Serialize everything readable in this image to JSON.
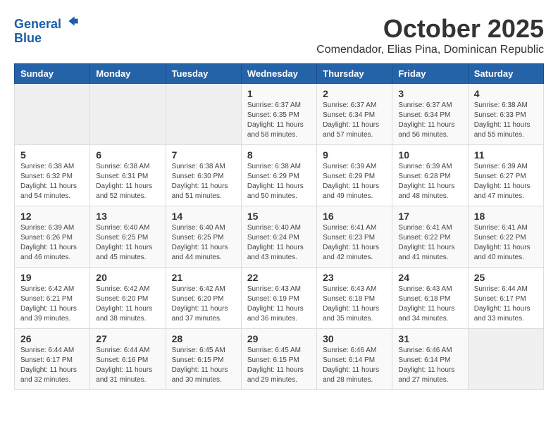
{
  "header": {
    "logo_line1": "General",
    "logo_line2": "Blue",
    "month": "October 2025",
    "location": "Comendador, Elias Pina, Dominican Republic"
  },
  "weekdays": [
    "Sunday",
    "Monday",
    "Tuesday",
    "Wednesday",
    "Thursday",
    "Friday",
    "Saturday"
  ],
  "weeks": [
    [
      {
        "day": "",
        "info": ""
      },
      {
        "day": "",
        "info": ""
      },
      {
        "day": "",
        "info": ""
      },
      {
        "day": "1",
        "info": "Sunrise: 6:37 AM\nSunset: 6:35 PM\nDaylight: 11 hours and 58 minutes."
      },
      {
        "day": "2",
        "info": "Sunrise: 6:37 AM\nSunset: 6:34 PM\nDaylight: 11 hours and 57 minutes."
      },
      {
        "day": "3",
        "info": "Sunrise: 6:37 AM\nSunset: 6:34 PM\nDaylight: 11 hours and 56 minutes."
      },
      {
        "day": "4",
        "info": "Sunrise: 6:38 AM\nSunset: 6:33 PM\nDaylight: 11 hours and 55 minutes."
      }
    ],
    [
      {
        "day": "5",
        "info": "Sunrise: 6:38 AM\nSunset: 6:32 PM\nDaylight: 11 hours and 54 minutes."
      },
      {
        "day": "6",
        "info": "Sunrise: 6:38 AM\nSunset: 6:31 PM\nDaylight: 11 hours and 52 minutes."
      },
      {
        "day": "7",
        "info": "Sunrise: 6:38 AM\nSunset: 6:30 PM\nDaylight: 11 hours and 51 minutes."
      },
      {
        "day": "8",
        "info": "Sunrise: 6:38 AM\nSunset: 6:29 PM\nDaylight: 11 hours and 50 minutes."
      },
      {
        "day": "9",
        "info": "Sunrise: 6:39 AM\nSunset: 6:29 PM\nDaylight: 11 hours and 49 minutes."
      },
      {
        "day": "10",
        "info": "Sunrise: 6:39 AM\nSunset: 6:28 PM\nDaylight: 11 hours and 48 minutes."
      },
      {
        "day": "11",
        "info": "Sunrise: 6:39 AM\nSunset: 6:27 PM\nDaylight: 11 hours and 47 minutes."
      }
    ],
    [
      {
        "day": "12",
        "info": "Sunrise: 6:39 AM\nSunset: 6:26 PM\nDaylight: 11 hours and 46 minutes."
      },
      {
        "day": "13",
        "info": "Sunrise: 6:40 AM\nSunset: 6:25 PM\nDaylight: 11 hours and 45 minutes."
      },
      {
        "day": "14",
        "info": "Sunrise: 6:40 AM\nSunset: 6:25 PM\nDaylight: 11 hours and 44 minutes."
      },
      {
        "day": "15",
        "info": "Sunrise: 6:40 AM\nSunset: 6:24 PM\nDaylight: 11 hours and 43 minutes."
      },
      {
        "day": "16",
        "info": "Sunrise: 6:41 AM\nSunset: 6:23 PM\nDaylight: 11 hours and 42 minutes."
      },
      {
        "day": "17",
        "info": "Sunrise: 6:41 AM\nSunset: 6:22 PM\nDaylight: 11 hours and 41 minutes."
      },
      {
        "day": "18",
        "info": "Sunrise: 6:41 AM\nSunset: 6:22 PM\nDaylight: 11 hours and 40 minutes."
      }
    ],
    [
      {
        "day": "19",
        "info": "Sunrise: 6:42 AM\nSunset: 6:21 PM\nDaylight: 11 hours and 39 minutes."
      },
      {
        "day": "20",
        "info": "Sunrise: 6:42 AM\nSunset: 6:20 PM\nDaylight: 11 hours and 38 minutes."
      },
      {
        "day": "21",
        "info": "Sunrise: 6:42 AM\nSunset: 6:20 PM\nDaylight: 11 hours and 37 minutes."
      },
      {
        "day": "22",
        "info": "Sunrise: 6:43 AM\nSunset: 6:19 PM\nDaylight: 11 hours and 36 minutes."
      },
      {
        "day": "23",
        "info": "Sunrise: 6:43 AM\nSunset: 6:18 PM\nDaylight: 11 hours and 35 minutes."
      },
      {
        "day": "24",
        "info": "Sunrise: 6:43 AM\nSunset: 6:18 PM\nDaylight: 11 hours and 34 minutes."
      },
      {
        "day": "25",
        "info": "Sunrise: 6:44 AM\nSunset: 6:17 PM\nDaylight: 11 hours and 33 minutes."
      }
    ],
    [
      {
        "day": "26",
        "info": "Sunrise: 6:44 AM\nSunset: 6:17 PM\nDaylight: 11 hours and 32 minutes."
      },
      {
        "day": "27",
        "info": "Sunrise: 6:44 AM\nSunset: 6:16 PM\nDaylight: 11 hours and 31 minutes."
      },
      {
        "day": "28",
        "info": "Sunrise: 6:45 AM\nSunset: 6:15 PM\nDaylight: 11 hours and 30 minutes."
      },
      {
        "day": "29",
        "info": "Sunrise: 6:45 AM\nSunset: 6:15 PM\nDaylight: 11 hours and 29 minutes."
      },
      {
        "day": "30",
        "info": "Sunrise: 6:46 AM\nSunset: 6:14 PM\nDaylight: 11 hours and 28 minutes."
      },
      {
        "day": "31",
        "info": "Sunrise: 6:46 AM\nSunset: 6:14 PM\nDaylight: 11 hours and 27 minutes."
      },
      {
        "day": "",
        "info": ""
      }
    ]
  ]
}
